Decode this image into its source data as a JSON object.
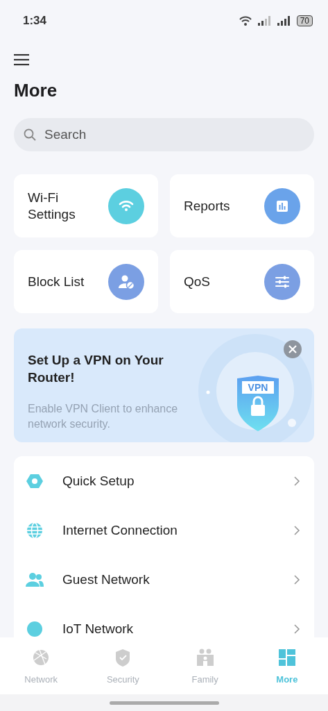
{
  "status_bar": {
    "time": "1:34",
    "battery": "70"
  },
  "title": "More",
  "search": {
    "placeholder": "Search"
  },
  "tiles": [
    {
      "label": "Wi-Fi Settings",
      "color": "#5ccfe0"
    },
    {
      "label": "Reports",
      "color": "#6aa3ea"
    },
    {
      "label": "Block List",
      "color": "#7b9fe3"
    },
    {
      "label": "QoS",
      "color": "#7b9fe3"
    }
  ],
  "banner": {
    "title": "Set Up a VPN on Your Router!",
    "text": "Enable VPN Client to enhance network security.",
    "badge": "VPN"
  },
  "list": [
    {
      "label": "Quick Setup"
    },
    {
      "label": "Internet Connection"
    },
    {
      "label": "Guest Network"
    },
    {
      "label": "IoT Network"
    }
  ],
  "nav": [
    {
      "label": "Network",
      "selected": false
    },
    {
      "label": "Security",
      "selected": false
    },
    {
      "label": "Family",
      "selected": false
    },
    {
      "label": "More",
      "selected": true
    }
  ]
}
